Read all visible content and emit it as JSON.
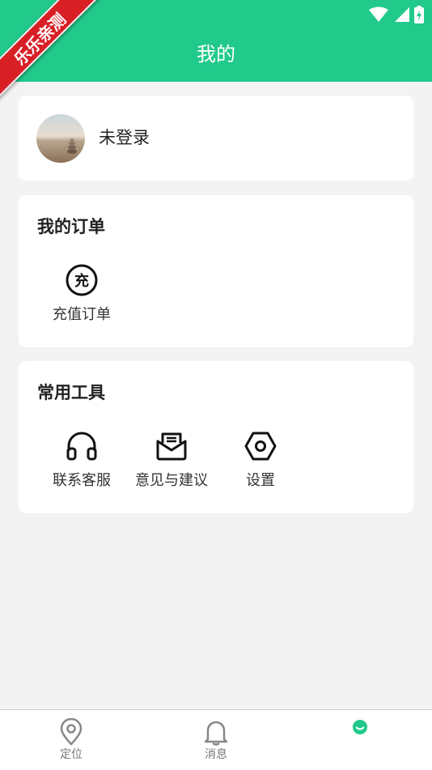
{
  "header": {
    "title": "我的",
    "watermark": "乐乐亲测"
  },
  "profile": {
    "name": "未登录"
  },
  "orders": {
    "title": "我的订单",
    "items": [
      {
        "label": "充值订单",
        "icon": "recharge-icon",
        "glyph": "充"
      }
    ]
  },
  "tools": {
    "title": "常用工具",
    "items": [
      {
        "label": "联系客服",
        "icon": "headset-icon"
      },
      {
        "label": "意见与建议",
        "icon": "feedback-mail-icon"
      },
      {
        "label": "设置",
        "icon": "settings-hexagon-icon"
      }
    ]
  },
  "nav": {
    "items": [
      {
        "label": "定位",
        "icon": "location-pin-icon"
      },
      {
        "label": "消息",
        "icon": "bell-icon"
      },
      {
        "label": "",
        "icon": "profile-icon"
      }
    ]
  },
  "colors": {
    "accent": "#21c98b",
    "background": "#f3f3f3",
    "card": "#ffffff",
    "ribbon": "#d81f26"
  }
}
